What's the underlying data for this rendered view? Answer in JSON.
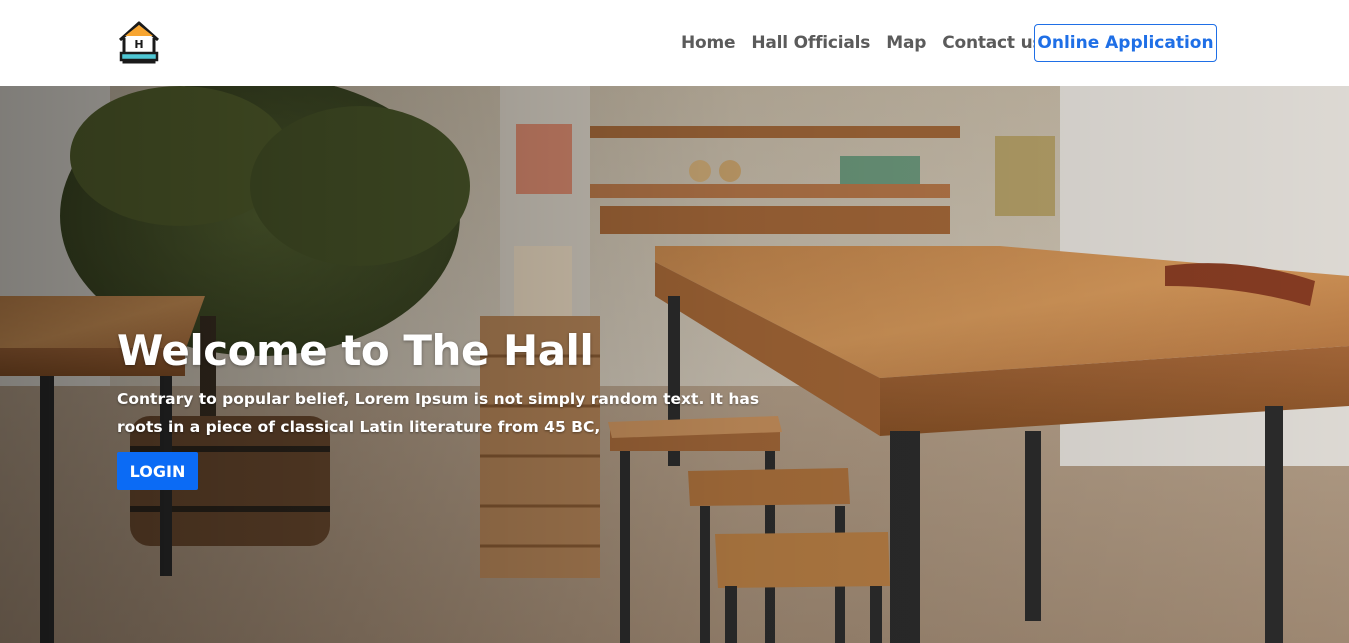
{
  "nav": {
    "logo_icon": "house-h-icon",
    "links": [
      {
        "label": "Home"
      },
      {
        "label": "Hall Officials"
      },
      {
        "label": "Map"
      },
      {
        "label": "Contact us"
      }
    ],
    "cta_label": "Online Application"
  },
  "hero": {
    "title": "Welcome to The Hall",
    "description": "Contrary to popular belief, Lorem Ipsum is not simply random text. It has roots in a piece of classical Latin literature from 45 BC,",
    "login_label": "LOGIN",
    "background": "cafe-interior-photo"
  },
  "colors": {
    "accent": "#1f6fe6",
    "login_button": "#0b6bf5",
    "nav_text": "#5b5b5b"
  }
}
